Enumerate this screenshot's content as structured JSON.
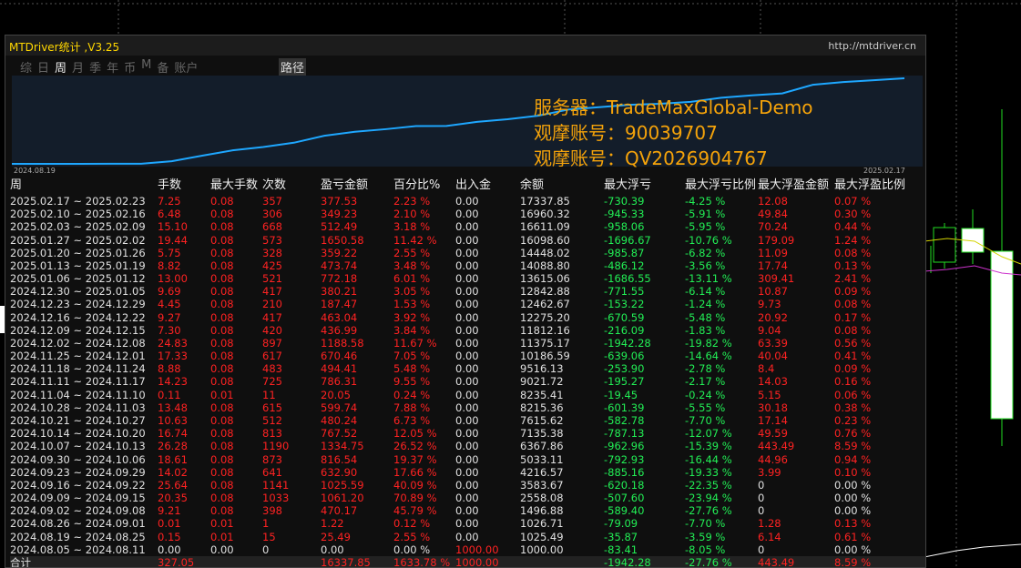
{
  "header": {
    "title": "MTDriver统计  ,V3.25",
    "url": "http://mtdriver.cn"
  },
  "tabs": [
    {
      "label": "综",
      "active": false
    },
    {
      "label": "日",
      "active": false
    },
    {
      "label": "周",
      "active": true
    },
    {
      "label": "月",
      "active": false
    },
    {
      "label": "季",
      "active": false
    },
    {
      "label": "年",
      "active": false
    },
    {
      "label": "币",
      "active": false
    },
    {
      "label": "M",
      "active": false
    },
    {
      "label": "备",
      "active": false
    },
    {
      "label": "账户",
      "active": false
    }
  ],
  "route_label": "路径",
  "mini_chart": {
    "start_date": "2024.08.19",
    "end_date": "2025.02.17",
    "line_color": "#1ea7ff",
    "balances": [
      1000,
      1025.49,
      1026.71,
      1496.88,
      2558.08,
      3583.67,
      4216.57,
      5033.11,
      6367.86,
      7135.38,
      7615.62,
      8215.36,
      8235.41,
      9021.72,
      9516.13,
      10186.59,
      11375.17,
      11812.16,
      12275.2,
      12462.67,
      12842.88,
      13615.06,
      14088.8,
      14448.02,
      16098.6,
      16611.09,
      16960.32,
      17337.85
    ]
  },
  "info": {
    "server": "服务器：TradeMaxGlobal-Demo",
    "account1": "观摩账号：90039707",
    "account2": "观摩账号：QV2026904767",
    "color": "#f5a30a"
  },
  "columns": [
    "周",
    "手数",
    "最大手数",
    "次数",
    "盈亏金额",
    "百分比%",
    "出入金",
    "余额",
    "最大浮亏",
    "最大浮亏比例",
    "最大浮盈金额",
    "最大浮盈比例"
  ],
  "colors": {
    "red": "#ff2222",
    "green": "#22ee55",
    "white": "#e0e0e0"
  },
  "rows": [
    [
      "2025.02.17 ~ 2025.02.23",
      "7.25",
      "0.08",
      "357",
      "377.53",
      "2.23 %",
      "0.00",
      "17337.85",
      "-730.39",
      "-4.25 %",
      "12.08",
      "0.07 %"
    ],
    [
      "2025.02.10 ~ 2025.02.16",
      "6.48",
      "0.08",
      "306",
      "349.23",
      "2.10 %",
      "0.00",
      "16960.32",
      "-945.33",
      "-5.91 %",
      "49.84",
      "0.30 %"
    ],
    [
      "2025.02.03 ~ 2025.02.09",
      "15.10",
      "0.08",
      "668",
      "512.49",
      "3.18 %",
      "0.00",
      "16611.09",
      "-958.06",
      "-5.95 %",
      "70.24",
      "0.44 %"
    ],
    [
      "2025.01.27 ~ 2025.02.02",
      "19.44",
      "0.08",
      "573",
      "1650.58",
      "11.42 %",
      "0.00",
      "16098.60",
      "-1696.67",
      "-10.76 %",
      "179.09",
      "1.24 %"
    ],
    [
      "2025.01.20 ~ 2025.01.26",
      "5.75",
      "0.08",
      "328",
      "359.22",
      "2.55 %",
      "0.00",
      "14448.02",
      "-985.87",
      "-6.82 %",
      "11.09",
      "0.08 %"
    ],
    [
      "2025.01.13 ~ 2025.01.19",
      "8.82",
      "0.08",
      "425",
      "473.74",
      "3.48 %",
      "0.00",
      "14088.80",
      "-486.12",
      "-3.56 %",
      "17.74",
      "0.13 %"
    ],
    [
      "2025.01.06 ~ 2025.01.12",
      "13.00",
      "0.08",
      "521",
      "772.18",
      "6.01 %",
      "0.00",
      "13615.06",
      "-1686.55",
      "-13.11 %",
      "309.41",
      "2.41 %"
    ],
    [
      "2024.12.30 ~ 2025.01.05",
      "9.69",
      "0.08",
      "417",
      "380.21",
      "3.05 %",
      "0.00",
      "12842.88",
      "-771.55",
      "-6.14 %",
      "10.87",
      "0.09 %"
    ],
    [
      "2024.12.23 ~ 2024.12.29",
      "4.45",
      "0.08",
      "210",
      "187.47",
      "1.53 %",
      "0.00",
      "12462.67",
      "-153.22",
      "-1.24 %",
      "9.73",
      "0.08 %"
    ],
    [
      "2024.12.16 ~ 2024.12.22",
      "9.27",
      "0.08",
      "417",
      "463.04",
      "3.92 %",
      "0.00",
      "12275.20",
      "-670.59",
      "-5.48 %",
      "20.92",
      "0.17 %"
    ],
    [
      "2024.12.09 ~ 2024.12.15",
      "7.30",
      "0.08",
      "420",
      "436.99",
      "3.84 %",
      "0.00",
      "11812.16",
      "-216.09",
      "-1.83 %",
      "9.04",
      "0.08 %"
    ],
    [
      "2024.12.02 ~ 2024.12.08",
      "24.83",
      "0.08",
      "897",
      "1188.58",
      "11.67 %",
      "0.00",
      "11375.17",
      "-1942.28",
      "-19.82 %",
      "63.39",
      "0.56 %"
    ],
    [
      "2024.11.25 ~ 2024.12.01",
      "17.33",
      "0.08",
      "617",
      "670.46",
      "7.05 %",
      "0.00",
      "10186.59",
      "-639.06",
      "-14.64 %",
      "40.04",
      "0.41 %"
    ],
    [
      "2024.11.18 ~ 2024.11.24",
      "8.88",
      "0.08",
      "483",
      "494.41",
      "5.48 %",
      "0.00",
      "9516.13",
      "-253.90",
      "-2.78 %",
      "8.4",
      "0.09 %"
    ],
    [
      "2024.11.11 ~ 2024.11.17",
      "14.23",
      "0.08",
      "725",
      "786.31",
      "9.55 %",
      "0.00",
      "9021.72",
      "-195.27",
      "-2.17 %",
      "14.03",
      "0.16 %"
    ],
    [
      "2024.11.04 ~ 2024.11.10",
      "0.11",
      "0.01",
      "11",
      "20.05",
      "0.24 %",
      "0.00",
      "8235.41",
      "-19.45",
      "-0.24 %",
      "5.15",
      "0.06 %"
    ],
    [
      "2024.10.28 ~ 2024.11.03",
      "13.48",
      "0.08",
      "615",
      "599.74",
      "7.88 %",
      "0.00",
      "8215.36",
      "-601.39",
      "-5.55 %",
      "30.18",
      "0.38 %"
    ],
    [
      "2024.10.21 ~ 2024.10.27",
      "10.63",
      "0.08",
      "512",
      "480.24",
      "6.73 %",
      "0.00",
      "7615.62",
      "-582.78",
      "-7.70 %",
      "17.14",
      "0.23 %"
    ],
    [
      "2024.10.14 ~ 2024.10.20",
      "16.74",
      "0.08",
      "813",
      "767.52",
      "12.05 %",
      "0.00",
      "7135.38",
      "-787.13",
      "-12.07 %",
      "49.59",
      "0.76 %"
    ],
    [
      "2024.10.07 ~ 2024.10.13",
      "26.28",
      "0.08",
      "1190",
      "1334.75",
      "26.52 %",
      "0.00",
      "6367.86",
      "-962.96",
      "-15.39 %",
      "443.49",
      "8.59 %"
    ],
    [
      "2024.09.30 ~ 2024.10.06",
      "18.61",
      "0.08",
      "873",
      "816.54",
      "19.37 %",
      "0.00",
      "5033.11",
      "-792.93",
      "-16.44 %",
      "44.96",
      "0.94 %"
    ],
    [
      "2024.09.23 ~ 2024.09.29",
      "14.02",
      "0.08",
      "641",
      "632.90",
      "17.66 %",
      "0.00",
      "4216.57",
      "-885.16",
      "-19.33 %",
      "3.99",
      "0.10 %"
    ],
    [
      "2024.09.16 ~ 2024.09.22",
      "25.64",
      "0.08",
      "1141",
      "1025.59",
      "40.09 %",
      "0.00",
      "3583.67",
      "-620.18",
      "-22.35 %",
      "0",
      "0.00 %"
    ],
    [
      "2024.09.09 ~ 2024.09.15",
      "20.35",
      "0.08",
      "1033",
      "1061.20",
      "70.89 %",
      "0.00",
      "2558.08",
      "-507.60",
      "-23.94 %",
      "0",
      "0.00 %"
    ],
    [
      "2024.09.02 ~ 2024.09.08",
      "9.21",
      "0.08",
      "398",
      "470.17",
      "45.79 %",
      "0.00",
      "1496.88",
      "-589.40",
      "-27.76 %",
      "0",
      "0.00 %"
    ],
    [
      "2024.08.26 ~ 2024.09.01",
      "0.01",
      "0.01",
      "1",
      "1.22",
      "0.12 %",
      "0.00",
      "1026.71",
      "-79.09",
      "-7.70 %",
      "1.28",
      "0.13 %"
    ],
    [
      "2024.08.19 ~ 2024.08.25",
      "0.15",
      "0.01",
      "15",
      "25.49",
      "2.55 %",
      "0.00",
      "1025.49",
      "-35.87",
      "-3.59 %",
      "6.14",
      "0.61 %"
    ],
    [
      "2024.08.05 ~ 2024.08.11",
      "0.00",
      "0.00",
      "0",
      "0.00",
      "0.00 %",
      "1000.00",
      "1000.00",
      "-83.41",
      "-8.05 %",
      "0",
      "0.00 %"
    ]
  ],
  "total": [
    "合计",
    "327.05",
    "",
    "",
    "16337.85",
    "1633.78 %",
    "1000.00",
    "",
    "-1942.28",
    "-27.76 %",
    "443.49",
    "8.59 %"
  ]
}
